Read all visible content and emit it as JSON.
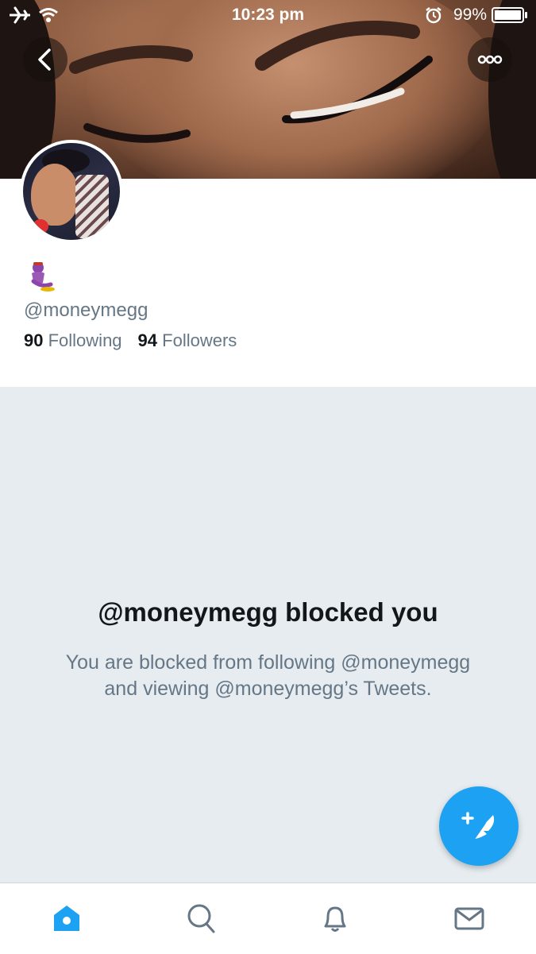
{
  "status_bar": {
    "time": "10:23 pm",
    "battery_percent": "99%"
  },
  "header": {
    "back_button": "back-chevron-icon",
    "more_button": "more-dots-icon"
  },
  "profile": {
    "handle": "@moneymegg",
    "following_count": "90",
    "following_label": "Following",
    "followers_count": "94",
    "followers_label": "Followers",
    "bio_emoji": "genie-emoji"
  },
  "blocked": {
    "title": "@moneymegg blocked you",
    "description": "You are blocked from following @moneymegg and viewing @moneymegg’s Tweets."
  },
  "tab_bar": {
    "tabs": [
      "home-icon",
      "search-icon",
      "notifications-icon",
      "messages-icon"
    ],
    "active": "home-icon"
  },
  "colors": {
    "accent": "#1da1f2",
    "muted_text": "#657786",
    "background": "#e6ecf0"
  }
}
